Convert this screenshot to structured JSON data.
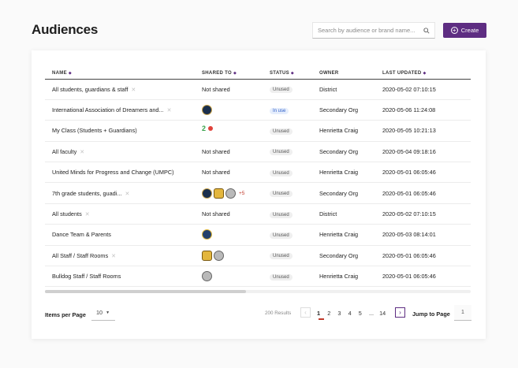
{
  "page": {
    "title": "Audiences"
  },
  "search": {
    "placeholder": "Search by audience or brand name..."
  },
  "create": {
    "label": "Create"
  },
  "table": {
    "headers": {
      "name": "NAME",
      "shared": "SHARED TO",
      "status": "STATUS",
      "owner": "OWNER",
      "updated": "LAST UPDATED"
    },
    "rows": [
      {
        "name": "All students, guardians & staff",
        "pinned": true,
        "shared_text": "Not shared",
        "logos": [],
        "status": "Unused",
        "owner": "District",
        "updated": "2020-05-02 07:10:15"
      },
      {
        "name": "International Association of Dreamers and...",
        "pinned": true,
        "shared_text": "",
        "logos": [
          "navy"
        ],
        "status": "In use",
        "owner": "Secondary Org",
        "updated": "2020-05-06 11:24:08"
      },
      {
        "name": "My Class (Students + Guardians)",
        "pinned": false,
        "shared_text": "",
        "logos": [
          "kid"
        ],
        "status": "Unused",
        "owner": "Henrietta Craig",
        "updated": "2020-05-05 10:21:13"
      },
      {
        "name": "All faculty",
        "pinned": true,
        "shared_text": "Not shared",
        "logos": [],
        "status": "Unused",
        "owner": "Secondary Org",
        "updated": "2020-05-04 09:18:16"
      },
      {
        "name": "United Minds for Progress and Change (UMPC)",
        "pinned": false,
        "shared_text": "Not shared",
        "logos": [],
        "status": "Unused",
        "owner": "Henrietta Craig",
        "updated": "2020-05-01 06:05:46"
      },
      {
        "name": "7th grade students, guadi...",
        "pinned": true,
        "shared_text": "",
        "logos": [
          "navy",
          "gold",
          "gray"
        ],
        "more": "+5",
        "status": "Unused",
        "owner": "Secondary Org",
        "updated": "2020-05-01 06:05:46"
      },
      {
        "name": "All students",
        "pinned": true,
        "shared_text": "Not shared",
        "logos": [],
        "status": "Unused",
        "owner": "District",
        "updated": "2020-05-02 07:10:15"
      },
      {
        "name": "Dance Team & Parents",
        "pinned": false,
        "shared_text": "",
        "logos": [
          "navy2"
        ],
        "status": "Unused",
        "owner": "Henrietta Craig",
        "updated": "2020-05-03 08:14:01"
      },
      {
        "name": "All Staff / Staff Rooms",
        "pinned": true,
        "shared_text": "",
        "logos": [
          "gold",
          "gray"
        ],
        "status": "Unused",
        "owner": "Secondary Org",
        "updated": "2020-05-01 06:05:46"
      },
      {
        "name": "Bulldog Staff / Staff Rooms",
        "pinned": false,
        "shared_text": "",
        "logos": [
          "gray"
        ],
        "status": "Unused",
        "owner": "Henrietta Craig",
        "updated": "2020-05-01 06:05:46"
      }
    ]
  },
  "pagination": {
    "items_per_page_label": "Items per Page",
    "items_per_page_value": "10",
    "results": "200 Results",
    "pages": [
      "1",
      "2",
      "3",
      "4",
      "5",
      "...",
      "14"
    ],
    "current": "1",
    "jump_label": "Jump to Page",
    "jump_value": "1"
  },
  "icons": {
    "search": "search-icon",
    "plus": "plus-circle-icon",
    "pin": "pin-off-icon",
    "sort": "sort-arrows-icon",
    "prev": "chevron-left-icon",
    "next": "chevron-right-icon",
    "caret": "caret-down-icon"
  },
  "colors": {
    "accent": "#5e2d82",
    "active_page": "#c0392b",
    "in_use_badge": "#2f5fc9"
  }
}
